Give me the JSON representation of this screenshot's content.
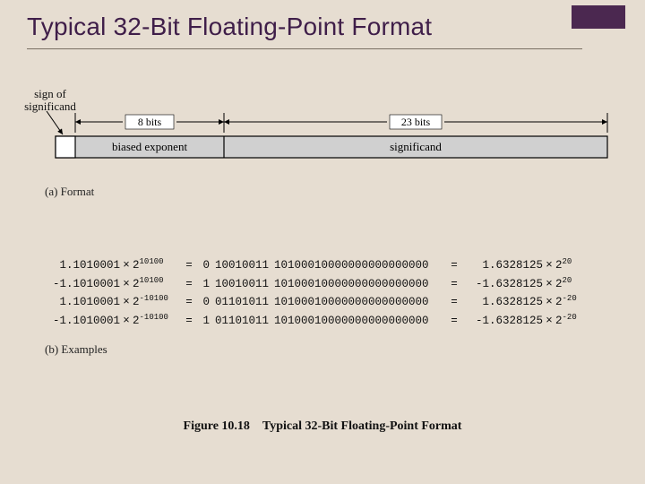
{
  "title": "Typical 32-Bit Floating-Point Format",
  "diagram": {
    "sign_label_line1": "sign of",
    "sign_label_line2": "significand",
    "dim_8bits": "8 bits",
    "dim_23bits": "23 bits",
    "field_exp": "biased exponent",
    "field_sig": "significand"
  },
  "captions": {
    "a": "(a) Format",
    "b": "(b) Examples",
    "fig_num": "Figure 10.18",
    "fig_title": "Typical 32-Bit Floating-Point Format"
  },
  "examples": [
    {
      "lhs_sign": "",
      "lhs_mant": "1.1010001",
      "lhs_exp": "10100",
      "bit_s": "0",
      "bit_exp": "10010011",
      "bit_sig": "10100010000000000000000",
      "dec_sign": "",
      "dec": "1.6328125",
      "pow": "20"
    },
    {
      "lhs_sign": "-",
      "lhs_mant": "1.1010001",
      "lhs_exp": "10100",
      "bit_s": "1",
      "bit_exp": "10010011",
      "bit_sig": "10100010000000000000000",
      "dec_sign": "-",
      "dec": "1.6328125",
      "pow": "20"
    },
    {
      "lhs_sign": "",
      "lhs_mant": "1.1010001",
      "lhs_exp": "-10100",
      "bit_s": "0",
      "bit_exp": "01101011",
      "bit_sig": "10100010000000000000000",
      "dec_sign": "",
      "dec": "1.6328125",
      "pow": "-20"
    },
    {
      "lhs_sign": "-",
      "lhs_mant": "1.1010001",
      "lhs_exp": "-10100",
      "bit_s": "1",
      "bit_exp": "01101011",
      "bit_sig": "10100010000000000000000",
      "dec_sign": "-",
      "dec": "1.6328125",
      "pow": "-20"
    }
  ],
  "symbols": {
    "times": "×",
    "eq": "=",
    "two": "2"
  }
}
